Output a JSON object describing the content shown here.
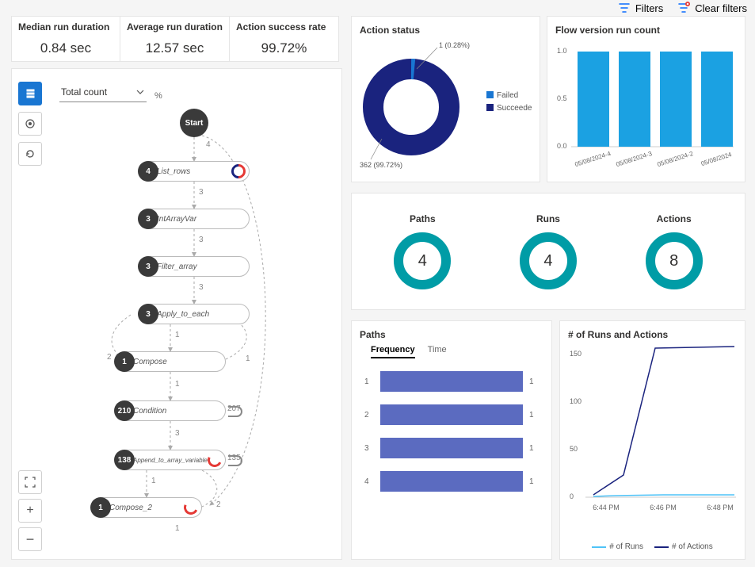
{
  "toolbar": {
    "filters": "Filters",
    "clear_filters": "Clear filters"
  },
  "kpis": [
    {
      "title": "Median run duration",
      "value": "0.84 sec"
    },
    {
      "title": "Average run duration",
      "value": "12.57 sec"
    },
    {
      "title": "Action success rate",
      "value": "99.72%"
    }
  ],
  "flow": {
    "dropdown": "Total count",
    "pct_symbol": "%",
    "start": "Start",
    "nodes": [
      {
        "count": "4",
        "label": "List_rows",
        "loop": null,
        "arc": "mix",
        "glow": false
      },
      {
        "count": "3",
        "label": "IntArrayVar",
        "loop": null,
        "arc": null,
        "glow": false
      },
      {
        "count": "3",
        "label": "Filter_array",
        "loop": null,
        "arc": null,
        "glow": false
      },
      {
        "count": "3",
        "label": "Apply_to_each",
        "loop": null,
        "arc": null,
        "glow": false
      },
      {
        "count": "1",
        "label": "Compose",
        "loop": null,
        "arc": null,
        "glow": false
      },
      {
        "count": "210",
        "label": "Condition",
        "loop": "207",
        "arc": null,
        "glow": true
      },
      {
        "count": "138",
        "label": "Append_to_array_variable",
        "loop": "135",
        "arc": "red",
        "glow": true
      },
      {
        "count": "1",
        "label": "Compose_2",
        "loop": null,
        "arc": "red",
        "glow": false
      }
    ],
    "edges": {
      "e0": "4",
      "e1": "3",
      "e2": "3",
      "e3": "3",
      "e4": "1",
      "right1": "1",
      "left2": "2",
      "e5": "1",
      "e6": "3",
      "e7": "1",
      "right2": "2",
      "e8": "1"
    }
  },
  "action_status": {
    "title": "Action status",
    "failed_label": "Failed",
    "succeeded_label": "Succeeded",
    "failed": "1 (0.28%)",
    "succeeded": "362 (99.72%)",
    "colors": {
      "failed": "#1976d2",
      "succeeded": "#1a237e"
    }
  },
  "flow_version": {
    "title": "Flow version run count",
    "ylabels": [
      "0.0",
      "0.5",
      "1.0"
    ],
    "bars": [
      {
        "label": "05/08/2024-4",
        "value": 1.0
      },
      {
        "label": "05/08/2024-3",
        "value": 1.0
      },
      {
        "label": "05/08/2024-2",
        "value": 1.0
      },
      {
        "label": "05/08/2024",
        "value": 1.0
      }
    ]
  },
  "summary": {
    "paths_label": "Paths",
    "paths": "4",
    "runs_label": "Runs",
    "runs": "4",
    "actions_label": "Actions",
    "actions": "8"
  },
  "paths_card": {
    "title": "Paths",
    "tabs": [
      "Frequency",
      "Time"
    ],
    "rows": [
      {
        "idx": "1",
        "val": "1"
      },
      {
        "idx": "2",
        "val": "1"
      },
      {
        "idx": "3",
        "val": "1"
      },
      {
        "idx": "4",
        "val": "1"
      }
    ]
  },
  "runs_actions": {
    "title": "# of Runs and Actions",
    "ylabels": [
      "0",
      "50",
      "100",
      "150"
    ],
    "xlabels": [
      "6:44 PM",
      "6:46 PM",
      "6:48 PM"
    ],
    "legend": [
      "# of Runs",
      "# of Actions"
    ]
  },
  "chart_data": [
    {
      "type": "pie",
      "title": "Action status",
      "series": [
        {
          "name": "Failed",
          "value": 1,
          "pct": 0.28
        },
        {
          "name": "Succeeded",
          "value": 362,
          "pct": 99.72
        }
      ]
    },
    {
      "type": "bar",
      "title": "Flow version run count",
      "categories": [
        "05/08/2024-4",
        "05/08/2024-3",
        "05/08/2024-2",
        "05/08/2024"
      ],
      "values": [
        1.0,
        1.0,
        1.0,
        1.0
      ],
      "ylim": [
        0,
        1.0
      ]
    },
    {
      "type": "bar",
      "title": "Paths Frequency",
      "categories": [
        "1",
        "2",
        "3",
        "4"
      ],
      "values": [
        1,
        1,
        1,
        1
      ]
    },
    {
      "type": "line",
      "title": "# of Runs and Actions",
      "x": [
        "6:44 PM",
        "6:46 PM",
        "6:48 PM"
      ],
      "series": [
        {
          "name": "# of Runs",
          "values": [
            1,
            3,
            3
          ]
        },
        {
          "name": "# of Actions",
          "values": [
            3,
            170,
            173
          ]
        }
      ],
      "ylim": [
        0,
        175
      ]
    }
  ]
}
